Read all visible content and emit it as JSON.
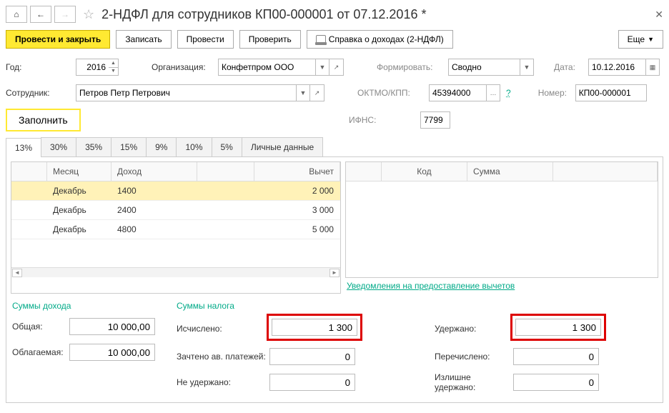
{
  "title": "2-НДФЛ для сотрудников КП00-000001 от 07.12.2016 *",
  "toolbar": {
    "post_close": "Провести и закрыть",
    "save": "Записать",
    "post": "Провести",
    "check": "Проверить",
    "print": "Справка о доходах (2-НДФЛ)",
    "more": "Еще"
  },
  "fields": {
    "year_lbl": "Год:",
    "year": "2016",
    "org_lbl": "Организация:",
    "org": "Конфетпром ООО",
    "form_lbl": "Формировать:",
    "form": "Сводно",
    "date_lbl": "Дата:",
    "date": "10.12.2016",
    "emp_lbl": "Сотрудник:",
    "emp": "Петров Петр Петрович",
    "oktmo_lbl": "ОКТМО/КПП:",
    "oktmo": "45394000",
    "num_lbl": "Номер:",
    "num": "КП00-000001",
    "fill": "Заполнить",
    "ifns_lbl": "ИФНС:",
    "ifns": "7799",
    "q": "?"
  },
  "tabs": [
    "13%",
    "30%",
    "35%",
    "15%",
    "9%",
    "10%",
    "5%",
    "Личные данные"
  ],
  "grid_left": {
    "headers": {
      "month": "Месяц",
      "income": "Доход",
      "ded": "Вычет"
    },
    "rows": [
      {
        "month": "Декабрь",
        "income": "1400",
        "ded": "2 000"
      },
      {
        "month": "Декабрь",
        "income": "2400",
        "ded": "3 000"
      },
      {
        "month": "Декабрь",
        "income": "4800",
        "ded": "5 000"
      }
    ]
  },
  "grid_right": {
    "headers": {
      "code": "Код",
      "sum": "Сумма"
    }
  },
  "link_notice": "Уведомления на предоставление вычетов",
  "sums": {
    "income_title": "Суммы дохода",
    "total_lbl": "Общая:",
    "total": "10 000,00",
    "taxable_lbl": "Облагаемая:",
    "taxable": "10 000,00",
    "tax_title": "Суммы налога",
    "calc_lbl": "Исчислено:",
    "calc": "1 300",
    "advance_lbl": "Зачтено ав. платежей:",
    "advance": "0",
    "nothold_lbl": "Не удержано:",
    "nothold": "0",
    "held_lbl": "Удержано:",
    "held": "1 300",
    "transf_lbl": "Перечислено:",
    "transf": "0",
    "excess_lbl": "Излишне удержано:",
    "excess": "0"
  }
}
